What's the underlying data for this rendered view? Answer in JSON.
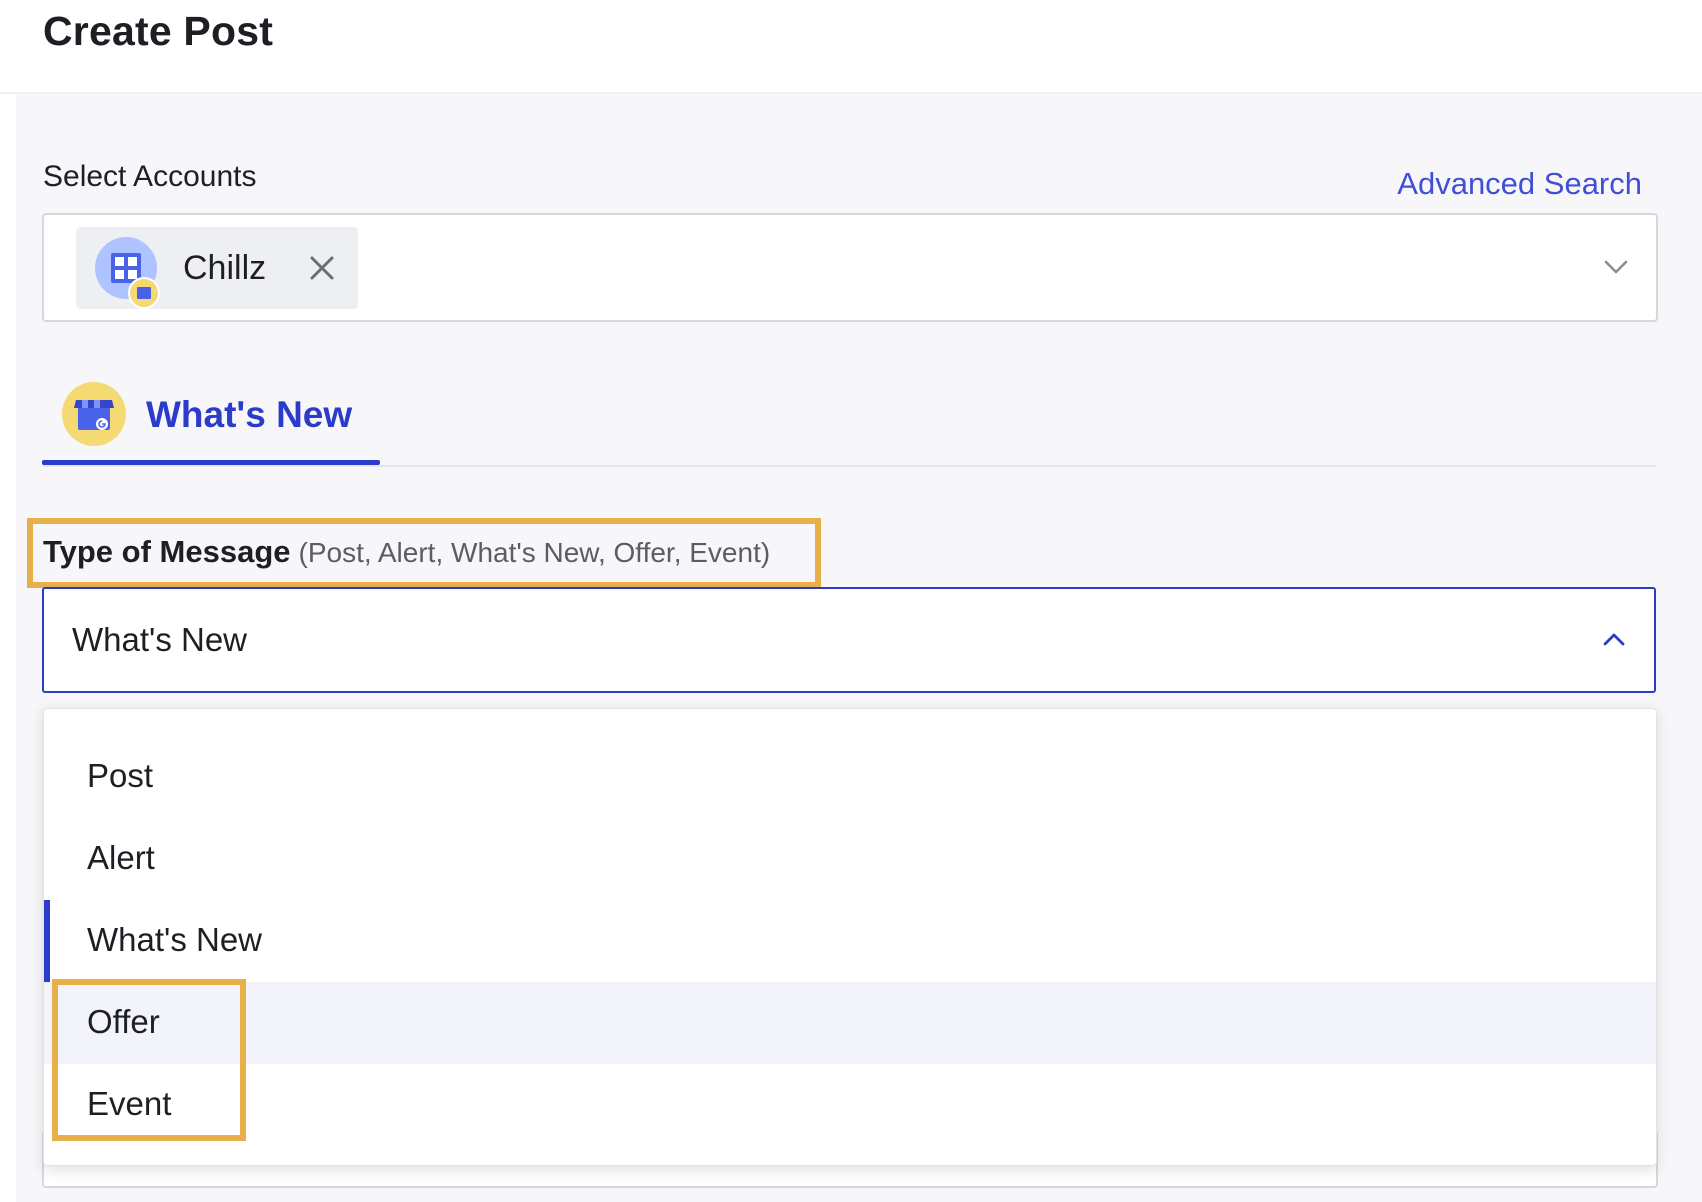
{
  "page": {
    "title": "Create Post"
  },
  "accounts": {
    "label": "Select Accounts",
    "advanced_search": "Advanced Search",
    "selected": [
      {
        "name": "Chillz",
        "icon": "store-grid-icon"
      }
    ]
  },
  "tab": {
    "label": "What's New",
    "icon": "google-my-business-icon"
  },
  "message_type": {
    "label": "Type of Message",
    "hint": "(Post, Alert, What's New, Offer, Event)",
    "value": "What's New",
    "options": [
      "Post",
      "Alert",
      "What's New",
      "Offer",
      "Event"
    ],
    "selected_index": 2,
    "hovered_index": 3
  },
  "colors": {
    "accent": "#2b3bcc",
    "link": "#3f4fd6",
    "highlight": "#e8b04b",
    "avatar": "#aec3ff",
    "badge": "#f5d973"
  }
}
